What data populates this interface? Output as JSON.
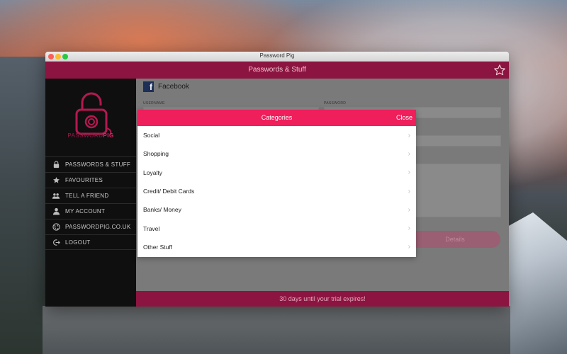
{
  "window": {
    "title": "Password Pig"
  },
  "appbar": {
    "title": "Passwords & Stuff",
    "favourite_icon": "star-outline-icon"
  },
  "sidebar": {
    "brand_prefix": "PASSWORD",
    "brand_suffix": "PIG",
    "items": [
      {
        "label": "PASSWORDS & STUFF",
        "icon": "lock-icon"
      },
      {
        "label": "FAVOURITES",
        "icon": "star-icon"
      },
      {
        "label": "TELL A FRIEND",
        "icon": "people-icon"
      },
      {
        "label": "MY ACCOUNT",
        "icon": "person-icon"
      },
      {
        "label": "PASSWORDPIG.CO.UK",
        "icon": "globe-icon"
      },
      {
        "label": "LOGOUT",
        "icon": "logout-icon"
      }
    ]
  },
  "main": {
    "entry_name": "Facebook",
    "username_label": "USERNAME",
    "password_label": "PASSWORD",
    "details_button": "Details"
  },
  "footer": {
    "trial_text": "30 days until your trial expires!"
  },
  "modal": {
    "title": "Categories",
    "close_label": "Close",
    "categories": [
      {
        "label": "Social"
      },
      {
        "label": "Shopping"
      },
      {
        "label": "Loyalty"
      },
      {
        "label": "Credit/ Debit Cards"
      },
      {
        "label": "Banks/ Money"
      },
      {
        "label": "Travel"
      },
      {
        "label": "Other Stuff"
      }
    ]
  },
  "colors": {
    "brand": "#8c1440",
    "accent": "#ee1f5b",
    "sidebar_bg": "#0f0f0f"
  }
}
